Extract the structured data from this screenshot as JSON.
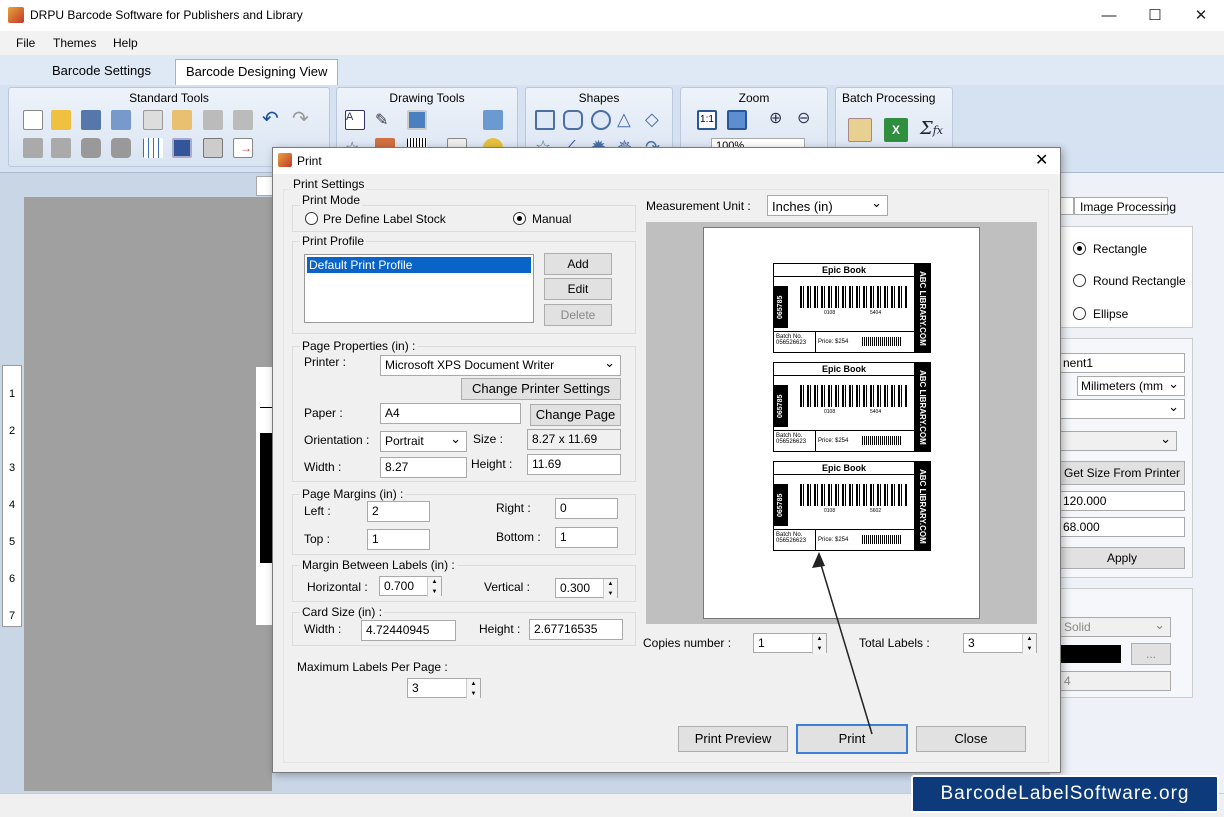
{
  "window": {
    "title": "DRPU Barcode Software for Publishers and Library"
  },
  "menu": [
    "File",
    "Themes",
    "Help"
  ],
  "tabs": [
    "Barcode Settings",
    "Barcode Designing View"
  ],
  "ribbon": {
    "groups": [
      "Standard Tools",
      "Drawing Tools",
      "Shapes",
      "Zoom",
      "Batch Processing"
    ],
    "zoom_value": "100%"
  },
  "right_panel": {
    "tab_partial": "d",
    "tab_image": "Image Processing",
    "shape_options": [
      "Rectangle",
      "Round Rectangle",
      "Ellipse"
    ],
    "name_value": "nent1",
    "unit_value": "Milimeters (mm",
    "get_size_button": "Get Size From Printer",
    "width_value": "120.000",
    "height_value": "68.000",
    "apply_button": "Apply",
    "border_style": "Solid",
    "border_width": "4",
    "ellipsis": "..."
  },
  "ruler": [
    "1",
    "2",
    "3",
    "4",
    "5",
    "6",
    "7"
  ],
  "dialog": {
    "title": "Print",
    "print_settings": "Print Settings",
    "print_mode": {
      "label": "Print Mode",
      "options": [
        "Pre Define Label Stock",
        "Manual"
      ]
    },
    "print_profile": {
      "label": "Print Profile",
      "items": [
        "Default Print Profile"
      ],
      "add": "Add",
      "edit": "Edit",
      "delete": "Delete"
    },
    "page_properties": {
      "label": "Page Properties (in) :",
      "printer_label": "Printer :",
      "printer_value": "Microsoft XPS Document Writer",
      "change_printer": "Change Printer Settings",
      "paper_label": "Paper :",
      "paper_value": "A4",
      "change_page": "Change Page",
      "orientation_label": "Orientation :",
      "orientation_value": "Portrait",
      "size_label": "Size :",
      "size_value": "8.27 x 11.69",
      "width_label": "Width :",
      "width_value": "8.27",
      "height_label": "Height :",
      "height_value": "11.69"
    },
    "page_margins": {
      "label": "Page Margins (in) :",
      "left_label": "Left :",
      "left_value": "2",
      "right_label": "Right :",
      "right_value": "0",
      "top_label": "Top :",
      "top_value": "1",
      "bottom_label": "Bottom :",
      "bottom_value": "1"
    },
    "margin_between": {
      "label": "Margin Between Labels (in) :",
      "horizontal_label": "Horizontal :",
      "horizontal_value": "0.700",
      "vertical_label": "Vertical :",
      "vertical_value": "0.300"
    },
    "card_size": {
      "label": "Card Size (in) :",
      "width_label": "Width :",
      "width_value": "4.72440945",
      "height_label": "Height :",
      "height_value": "2.67716535"
    },
    "max_labels": {
      "label": "Maximum Labels Per Page :",
      "value": "3"
    },
    "measurement": {
      "label": "Measurement Unit :",
      "value": "Inches (in)"
    },
    "copies": {
      "label": "Copies number :",
      "value": "1"
    },
    "total_labels": {
      "label": "Total Labels :",
      "value": "3"
    },
    "buttons": {
      "preview": "Print Preview",
      "print": "Print",
      "close": "Close"
    },
    "labels_preview": [
      {
        "title": "Epic Book",
        "side": "ABC LIBRARY.COM",
        "code": "065785",
        "batch_label": "Batch No.",
        "batch": "056526623",
        "price": "Price: $254",
        "nums": [
          "0108",
          "5404"
        ]
      },
      {
        "title": "Epic Book",
        "side": "ABC LIBRARY.COM",
        "code": "065785",
        "batch_label": "Batch No.",
        "batch": "056526623",
        "price": "Price: $254",
        "nums": [
          "0108",
          "5404"
        ]
      },
      {
        "title": "Epic Book",
        "side": "ABC LIBRARY.COM",
        "code": "065785",
        "batch_label": "Batch No.",
        "batch": "056526623",
        "price": "Price: $254",
        "nums": [
          "0108",
          "5602"
        ]
      }
    ]
  },
  "watermark": "BarcodeLabelSoftware.org"
}
